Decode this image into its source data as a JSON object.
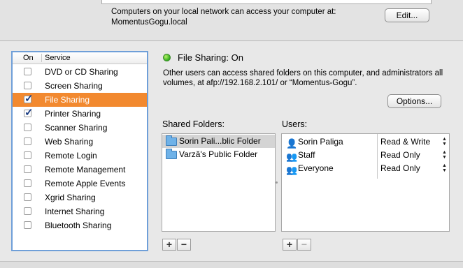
{
  "top": {
    "local_network_text": "Computers on your local network can access your computer at:",
    "hostname": "MomentusGogu.local",
    "edit_button": "Edit..."
  },
  "service_list": {
    "header_on": "On",
    "header_service": "Service",
    "items": [
      {
        "label": "DVD or CD Sharing",
        "checked": false,
        "selected": false
      },
      {
        "label": "Screen Sharing",
        "checked": false,
        "selected": false
      },
      {
        "label": "File Sharing",
        "checked": true,
        "selected": true
      },
      {
        "label": "Printer Sharing",
        "checked": true,
        "selected": false
      },
      {
        "label": "Scanner Sharing",
        "checked": false,
        "selected": false
      },
      {
        "label": "Web Sharing",
        "checked": false,
        "selected": false
      },
      {
        "label": "Remote Login",
        "checked": false,
        "selected": false
      },
      {
        "label": "Remote Management",
        "checked": false,
        "selected": false
      },
      {
        "label": "Remote Apple Events",
        "checked": false,
        "selected": false
      },
      {
        "label": "Xgrid Sharing",
        "checked": false,
        "selected": false
      },
      {
        "label": "Internet Sharing",
        "checked": false,
        "selected": false
      },
      {
        "label": "Bluetooth Sharing",
        "checked": false,
        "selected": false
      }
    ]
  },
  "status": {
    "title": "File Sharing: On",
    "description": "Other users can access shared folders on this computer, and administrators all volumes, at afp://192.168.2.101/ or “Momentus-Gogu”.",
    "indicator_color": "#2fae1b"
  },
  "options_button": "Options...",
  "shared_folders": {
    "label": "Shared Folders:",
    "items": [
      {
        "name": "Sorin Pali...blic Folder",
        "selected": true
      },
      {
        "name": "Varză's Public Folder",
        "selected": false
      }
    ]
  },
  "users": {
    "label": "Users:",
    "items": [
      {
        "name": "Sorin Paliga",
        "permission": "Read & Write",
        "icon": "single-user-icon"
      },
      {
        "name": "Staff",
        "permission": "Read Only",
        "icon": "group-icon"
      },
      {
        "name": "Everyone",
        "permission": "Read Only",
        "icon": "group-icon"
      }
    ]
  },
  "buttons": {
    "add": "+",
    "remove": "−"
  },
  "colors": {
    "selection": "#f2892f",
    "list_focus_border": "#6f9fd8"
  }
}
